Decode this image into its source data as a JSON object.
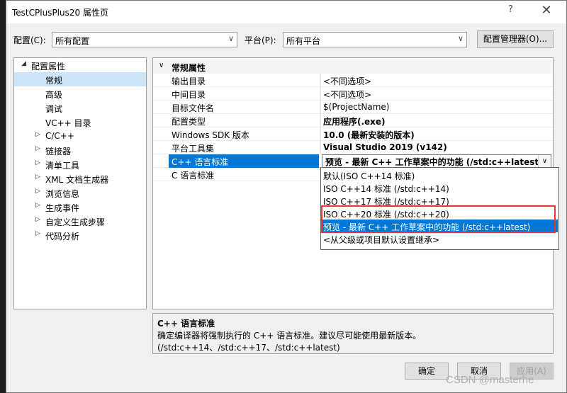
{
  "window": {
    "title": "TestCPlusPlus20 属性页",
    "help": "?",
    "close": "✕"
  },
  "config_bar": {
    "configuration_label": "配置(C):",
    "configuration_value": "所有配置",
    "platform_label": "平台(P):",
    "platform_value": "所有平台",
    "manager_button": "配置管理器(O)..."
  },
  "tree": {
    "root": "配置属性",
    "items": [
      {
        "label": "常规",
        "selected": true
      },
      {
        "label": "高级"
      },
      {
        "label": "调试"
      },
      {
        "label": "VC++ 目录"
      },
      {
        "label": "C/C++",
        "expandable": true
      },
      {
        "label": "链接器",
        "expandable": true
      },
      {
        "label": "清单工具",
        "expandable": true
      },
      {
        "label": "XML 文档生成器",
        "expandable": true
      },
      {
        "label": "浏览信息",
        "expandable": true
      },
      {
        "label": "生成事件",
        "expandable": true
      },
      {
        "label": "自定义生成步骤",
        "expandable": true
      },
      {
        "label": "代码分析",
        "expandable": true
      }
    ]
  },
  "grid": {
    "category": "常规属性",
    "rows": [
      {
        "name": "输出目录",
        "value": "<不同选项>"
      },
      {
        "name": "中间目录",
        "value": "<不同选项>"
      },
      {
        "name": "目标文件名",
        "value": "$(ProjectName)"
      },
      {
        "name": "配置类型",
        "value": "应用程序(.exe)",
        "bold": true
      },
      {
        "name": "Windows SDK 版本",
        "value": "10.0 (最新安装的版本)",
        "bold": true
      },
      {
        "name": "平台工具集",
        "value": "Visual Studio 2019 (v142)",
        "bold": true
      },
      {
        "name": "C++ 语言标准",
        "value": "预览 - 最新 C++ 工作草案中的功能 (/std:c++latest)",
        "bold": true,
        "selected": true
      },
      {
        "name": "C 语言标准",
        "value": ""
      }
    ]
  },
  "dropdown": {
    "options": [
      "默认(ISO C++14 标准)",
      "ISO C++14 标准 (/std:c++14)",
      "ISO C++17 标准 (/std:c++17)",
      "ISO C++20 标准 (/std:c++20)",
      "预览 - 最新 C++ 工作草案中的功能 (/std:c++latest)",
      "<从父级或项目默认设置继承>"
    ],
    "highlighted_index": 4
  },
  "description": {
    "title": "C++ 语言标准",
    "text": "确定编译器将强制执行的 C++ 语言标准。建议尽可能使用最新版本。(/std:c++14、/std:c++17、/std:c++latest)"
  },
  "buttons": {
    "ok": "确定",
    "cancel": "取消",
    "apply": "应用(A)"
  },
  "watermark": "CSDN @masterhe",
  "colors": {
    "selection": "#0078d7",
    "highlight_box": "#e53935",
    "tree_selection": "#cce4f7"
  }
}
